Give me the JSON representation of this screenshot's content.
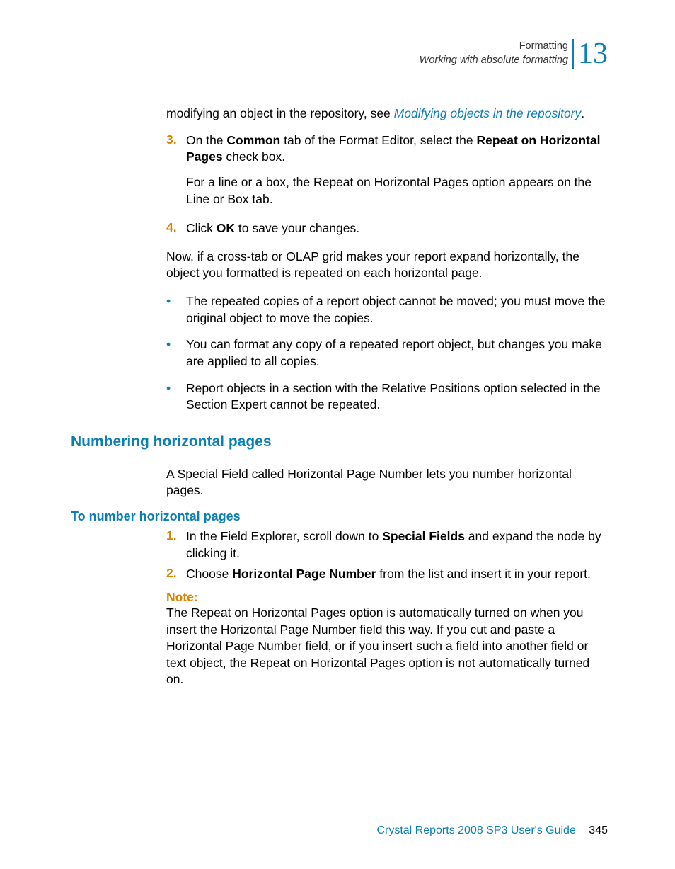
{
  "header": {
    "chapter_label": "Formatting",
    "breadcrumb": "Working with absolute formatting",
    "chapter_number": "13"
  },
  "intro": {
    "lead_text": "modifying an object in the repository, see ",
    "link_text": "Modifying objects in the repository",
    "tail_text": "."
  },
  "step3": {
    "num": "3.",
    "t1": "On the ",
    "b1": "Common",
    "t2": " tab of the Format Editor, select the ",
    "b2": "Repeat on Horizontal Pages",
    "t3": " check box.",
    "sub": "For a line or a box, the Repeat on Horizontal Pages option appears on the Line or Box tab."
  },
  "step4": {
    "num": "4.",
    "t1": "Click ",
    "b1": "OK",
    "t2": " to save your changes."
  },
  "para_after_steps": "Now, if a cross-tab or OLAP grid makes your report expand horizontally, the object you formatted is repeated on each horizontal page.",
  "bullets": [
    "The repeated copies of a report object cannot be moved; you must move the original object to move the copies.",
    "You can format any copy of a repeated report object, but changes you make are applied to all copies.",
    "Report objects in a section with the Relative Positions option selected in the Section Expert cannot be repeated."
  ],
  "h2": "Numbering horizontal pages",
  "h2_para": "A Special Field called Horizontal Page Number lets you number horizontal pages.",
  "h3": "To number horizontal pages",
  "n_step1": {
    "num": "1.",
    "t1": "In the Field Explorer, scroll down to ",
    "b1": "Special Fields",
    "t2": " and expand the node by clicking it."
  },
  "n_step2": {
    "num": "2.",
    "t1": "Choose ",
    "b1": "Horizontal Page Number",
    "t2": " from the list and insert it in your report."
  },
  "note": {
    "label": "Note:",
    "body": "The Repeat on Horizontal Pages option is automatically turned on when you insert the Horizontal Page Number field this way. If you cut and paste a Horizontal Page Number field, or if you insert such a field into another field or text object, the Repeat on Horizontal Pages option is not automatically turned on."
  },
  "footer": {
    "title": "Crystal Reports 2008 SP3 User's Guide",
    "page": "345"
  }
}
